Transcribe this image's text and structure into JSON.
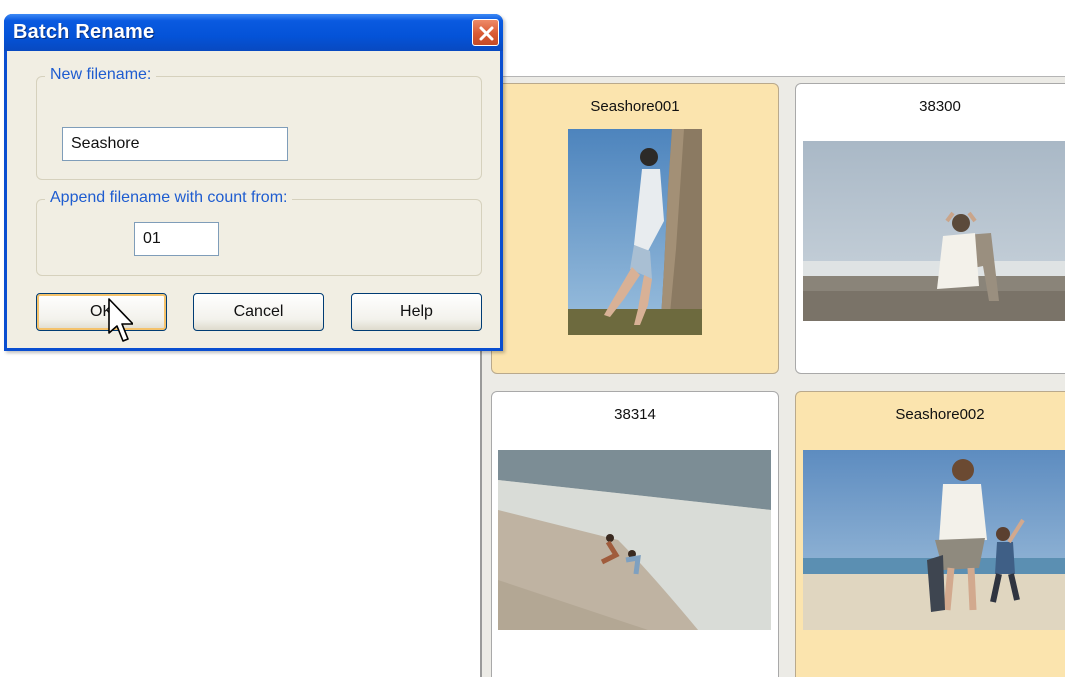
{
  "dialog": {
    "title": "Batch Rename",
    "new_filename_label": "New filename:",
    "new_filename_value": "Seashore",
    "append_label": "Append filename with count from:",
    "count_value": "01",
    "ok_label": "OK",
    "cancel_label": "Cancel",
    "help_label": "Help",
    "close_icon": "close-x-icon"
  },
  "browser": {
    "thumbnails": [
      {
        "caption": "Seashore001",
        "selected": true,
        "photo": "woman leaning against a rock"
      },
      {
        "caption": "38300",
        "selected": false,
        "photo": "person in a beach chair on sand"
      },
      {
        "caption": "38314",
        "selected": false,
        "photo": "children doing cartwheels at the surf"
      },
      {
        "caption": "Seashore002",
        "selected": true,
        "photo": "woman and child walking on beach"
      }
    ],
    "selected_color": "#fbe4ae"
  }
}
